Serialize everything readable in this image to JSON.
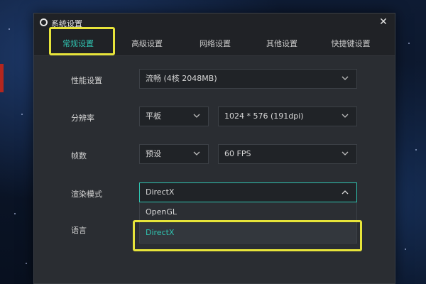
{
  "window": {
    "title": "系统设置",
    "close_icon": "close-icon"
  },
  "tabs": [
    {
      "label": "常规设置",
      "active": true
    },
    {
      "label": "高级设置",
      "active": false
    },
    {
      "label": "网络设置",
      "active": false
    },
    {
      "label": "其他设置",
      "active": false
    },
    {
      "label": "快捷键设置",
      "active": false
    }
  ],
  "settings": {
    "performance": {
      "label": "性能设置",
      "value": "流畅 (4核 2048MB)"
    },
    "resolution": {
      "label": "分辨率",
      "mode": "平板",
      "value": "1024 * 576 (191dpi)"
    },
    "fps": {
      "label": "帧数",
      "mode": "预设",
      "value": "60 FPS"
    },
    "render": {
      "label": "渲染模式",
      "value": "DirectX",
      "options": [
        "OpenGL",
        "DirectX"
      ],
      "selected_option": "DirectX"
    },
    "language": {
      "label": "语言"
    }
  },
  "colors": {
    "accent": "#2fc3b0",
    "highlight": "#e7e43a",
    "panel": "#2a2d32"
  }
}
